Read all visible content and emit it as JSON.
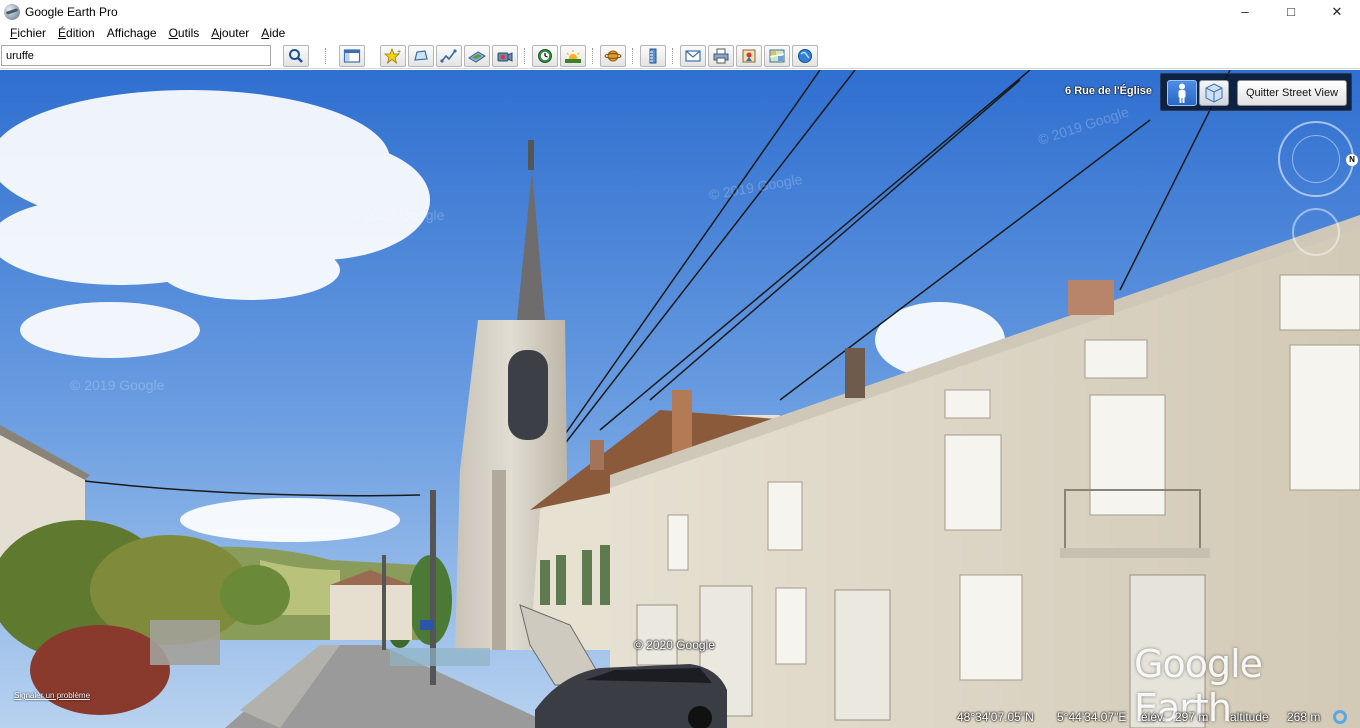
{
  "window": {
    "title": "Google Earth Pro",
    "controls": {
      "minimize": "–",
      "maximize": "□",
      "close": "✕"
    }
  },
  "menu": [
    {
      "accel": "F",
      "rest": "ichier"
    },
    {
      "accel": "É",
      "rest": "dition"
    },
    {
      "accel": "",
      "rest": "Affichage"
    },
    {
      "accel": "O",
      "rest": "utils"
    },
    {
      "accel": "A",
      "rest": "jouter"
    },
    {
      "accel": "A",
      "rest": "ide"
    }
  ],
  "search": {
    "value": "uruffe"
  },
  "toolbar_icons": [
    "search-icon",
    "sidebar-toggle-icon",
    "placemark-icon",
    "polygon-icon",
    "path-icon",
    "image-overlay-icon",
    "record-tour-icon",
    "historical-imagery-icon",
    "sunlight-icon",
    "planets-icon",
    "ruler-icon",
    "email-icon",
    "print-icon",
    "save-image-icon",
    "view-in-maps-icon",
    "earth-gallery-icon"
  ],
  "streetview": {
    "address": "6 Rue de l'Église",
    "quit_label": "Quitter Street View"
  },
  "navigation": {
    "north": "N"
  },
  "viewport": {
    "copyright": "© 2020 Google",
    "logo": "Google Earth",
    "report_link": "Signaler un problème"
  },
  "status": {
    "latitude": "48°34'07.05\"N",
    "longitude": "5°44'34.07\"E",
    "elevation_label": "élév.",
    "elevation_value": "297 m",
    "altitude_label": "altitude",
    "altitude_value": "268 m"
  },
  "colors": {
    "sky_top": "#2f6fd0",
    "sky_bottom": "#9fc3ef",
    "facade": "#ddd6c6",
    "accent_blue": "#2c67c4"
  }
}
